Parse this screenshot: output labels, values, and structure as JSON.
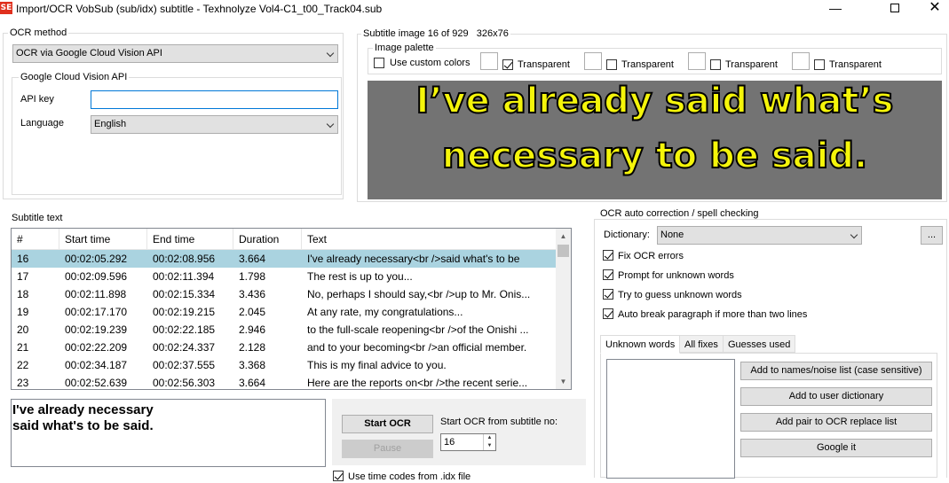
{
  "window": {
    "icon_text": "SE",
    "title": "Import/OCR VobSub (sub/idx) subtitle - Texhnolyze Vol4-C1_t00_Track04.sub",
    "minimize": "—",
    "close": "✕"
  },
  "ocr_method": {
    "group_title": "OCR method",
    "selected": "OCR via Google Cloud Vision API",
    "gcv": {
      "group_title": "Google Cloud Vision API",
      "api_key_label": "API key",
      "api_key_value": "",
      "language_label": "Language",
      "language_selected": "English"
    }
  },
  "subtitle_image": {
    "group_title": "Subtitle image 16 of 929   326x76",
    "palette": {
      "group_title": "Image palette",
      "custom_colors_label": "Use custom colors",
      "custom_colors_checked": false,
      "transparent_label": "Transparent",
      "slots": [
        {
          "checked": true
        },
        {
          "checked": false
        },
        {
          "checked": false
        },
        {
          "checked": false
        }
      ]
    },
    "image_lines": [
      "I’ve already said what’s",
      "necessary to be said."
    ],
    "image_bg": "#737373",
    "text_color": "#f5f50a"
  },
  "subtitle_text": {
    "group_title": "Subtitle text",
    "columns": [
      "#",
      "Start time",
      "End time",
      "Duration",
      "Text"
    ],
    "rows": [
      {
        "num": "16",
        "start": "00:02:05.292",
        "end": "00:02:08.956",
        "dur": "3.664",
        "text": "I've already necessary<br />said what's to be",
        "selected": true
      },
      {
        "num": "17",
        "start": "00:02:09.596",
        "end": "00:02:11.394",
        "dur": "1.798",
        "text": "The rest is up to you..."
      },
      {
        "num": "18",
        "start": "00:02:11.898",
        "end": "00:02:15.334",
        "dur": "3.436",
        "text": "No, perhaps I should say,<br />up to Mr. Onis..."
      },
      {
        "num": "19",
        "start": "00:02:17.170",
        "end": "00:02:19.215",
        "dur": "2.045",
        "text": "At any rate, my congratulations..."
      },
      {
        "num": "20",
        "start": "00:02:19.239",
        "end": "00:02:22.185",
        "dur": "2.946",
        "text": "to the full-scale reopening<br />of the Onishi ..."
      },
      {
        "num": "21",
        "start": "00:02:22.209",
        "end": "00:02:24.337",
        "dur": "2.128",
        "text": "and to your becoming<br />an official member."
      },
      {
        "num": "22",
        "start": "00:02:34.187",
        "end": "00:02:37.555",
        "dur": "3.368",
        "text": "This is my final advice to you."
      },
      {
        "num": "23",
        "start": "00:02:52.639",
        "end": "00:02:56.303",
        "dur": "3.664",
        "text": "Here are the reports on<br />the recent serie..."
      }
    ],
    "current_text_line1": "I've already necessary",
    "current_text_line2": "said what's to be said."
  },
  "ocr_controls": {
    "start_label": "Start OCR",
    "pause_label": "Pause",
    "start_from_label": "Start OCR from subtitle no:",
    "start_from_value": "16",
    "use_timecodes_label": "Use time codes from .idx file",
    "use_timecodes_checked": true
  },
  "auto_correction": {
    "group_title": "OCR auto correction / spell checking",
    "dictionary_label": "Dictionary:",
    "dictionary_selected": "None",
    "browse_label": "...",
    "options": [
      {
        "label": "Fix OCR errors",
        "checked": true
      },
      {
        "label": "Prompt for unknown words",
        "checked": true
      },
      {
        "label": "Try to guess unknown words",
        "checked": true
      },
      {
        "label": "Auto break paragraph if more than two lines",
        "checked": true
      }
    ],
    "tabs": [
      "Unknown words",
      "All fixes",
      "Guesses used"
    ],
    "active_tab": 0,
    "buttons": [
      "Add to names/noise list (case sensitive)",
      "Add to user dictionary",
      "Add pair to OCR replace list",
      "Google it"
    ]
  }
}
